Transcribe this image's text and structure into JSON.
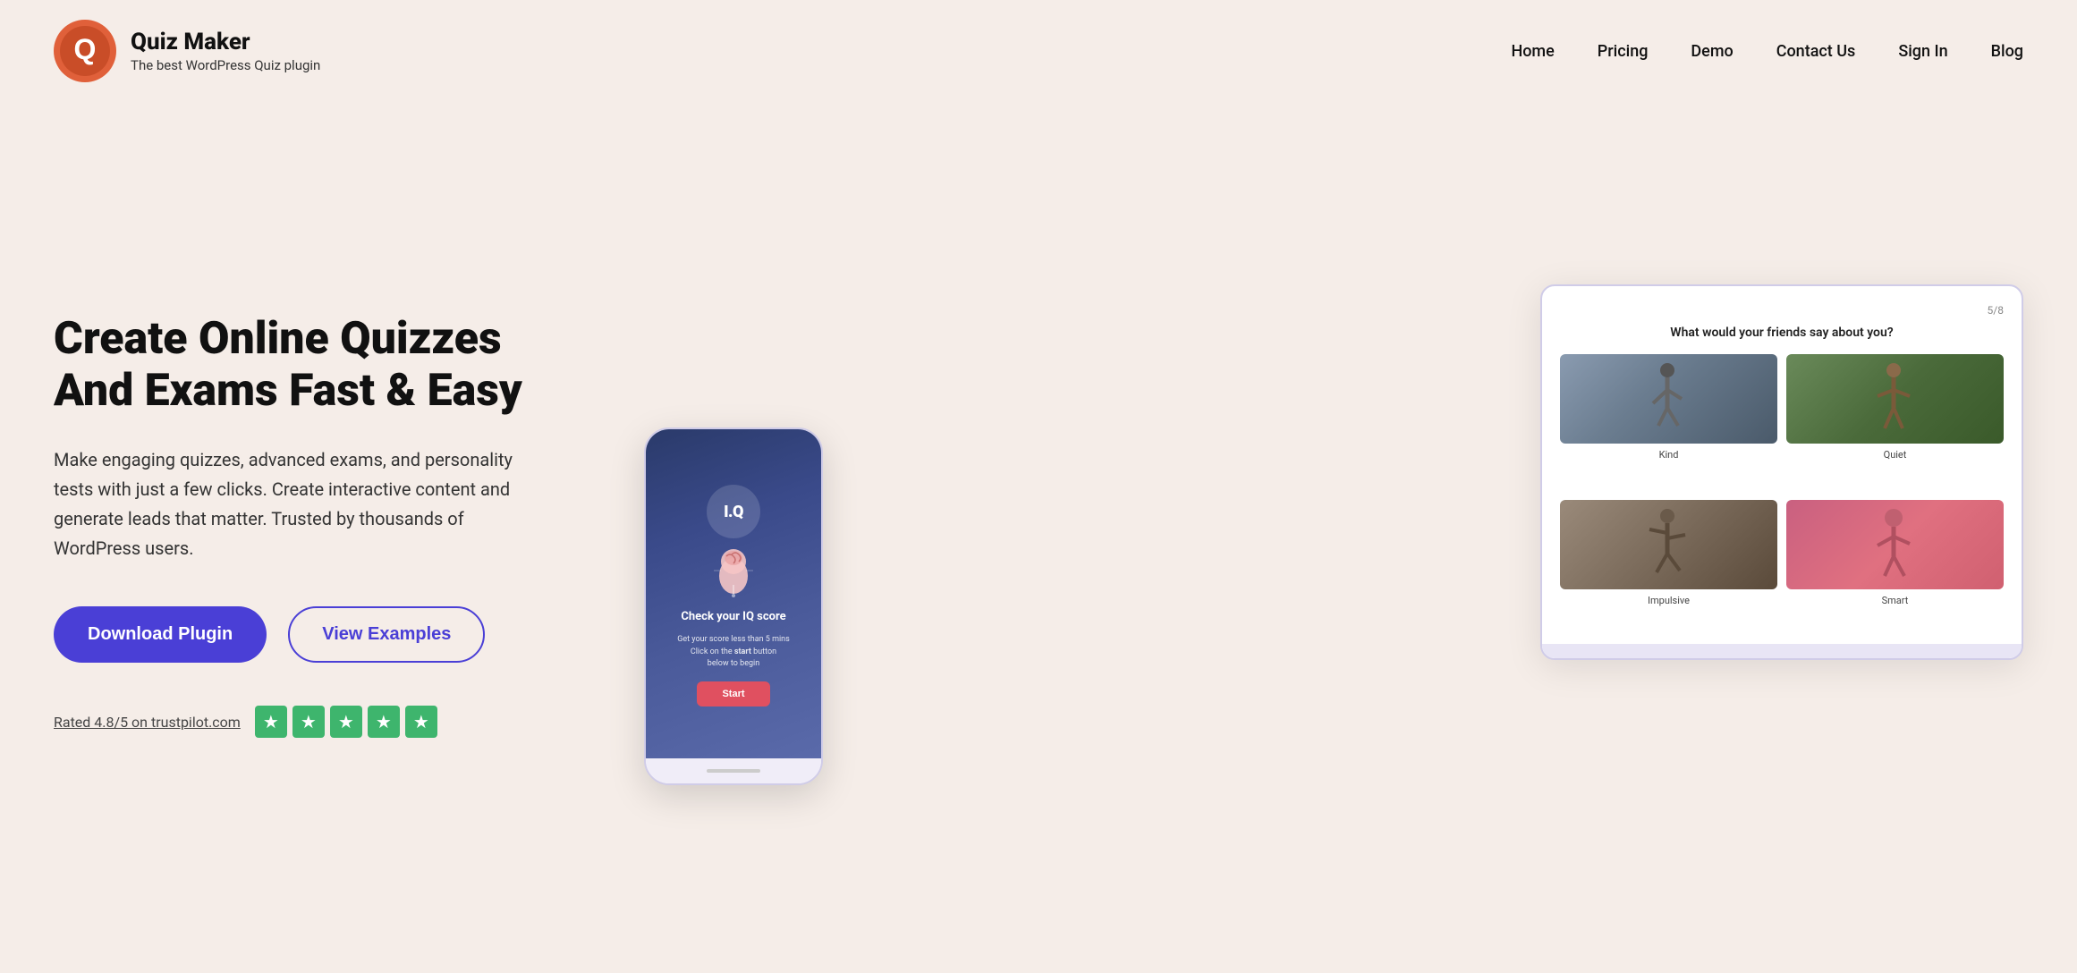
{
  "header": {
    "logo": {
      "title": "Quiz Maker",
      "subtitle": "The best WordPress Quiz plugin",
      "icon_alt": "Quiz Maker logo"
    },
    "nav": {
      "items": [
        {
          "label": "Home",
          "id": "home"
        },
        {
          "label": "Pricing",
          "id": "pricing"
        },
        {
          "label": "Demo",
          "id": "demo"
        },
        {
          "label": "Contact Us",
          "id": "contact"
        },
        {
          "label": "Sign In",
          "id": "signin"
        },
        {
          "label": "Blog",
          "id": "blog"
        }
      ]
    }
  },
  "hero": {
    "heading": "Create Online Quizzes And Exams Fast & Easy",
    "description": "Make engaging quizzes, advanced exams, and personality tests with just a few clicks. Create interactive content and generate leads that matter. Trusted by thousands of WordPress users.",
    "buttons": {
      "download": "Download Plugin",
      "examples": "View Examples"
    },
    "rating": {
      "text": "Rated 4.8/5 on trustpilot.com",
      "stars": 5
    }
  },
  "tablet_mockup": {
    "progress": "5/8",
    "question": "What would your friends say about you?",
    "options": [
      {
        "label": "Kind"
      },
      {
        "label": "Quiet"
      },
      {
        "label": "Impulsive"
      },
      {
        "label": "Smart"
      }
    ]
  },
  "phone_mockup": {
    "iq_label": "I.Q",
    "title": "Check your IQ score",
    "subtitle": "Get your score less than 5 mins\nClick on the start button\nbelow to begin",
    "start_button": "Start"
  }
}
